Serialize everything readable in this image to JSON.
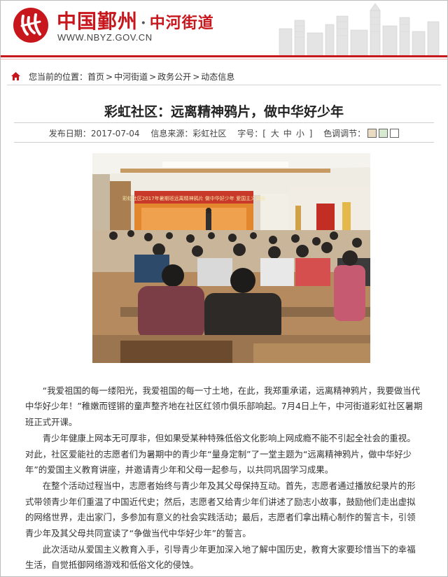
{
  "header": {
    "site_name": "中国鄞州",
    "dot": "·",
    "subsite": "中河街道",
    "url": "WWW.NBYZ.GOV.CN",
    "logo_icon": "yz-logo-icon",
    "accent_color": "#c8161d"
  },
  "breadcrumb": {
    "prefix": "您当前的位置：",
    "items": [
      "首页",
      "中河街道",
      "政务公开",
      "动态信息"
    ],
    "separator": ">"
  },
  "article": {
    "title": "彩虹社区：远离精神鸦片，做中华好少年",
    "date_label": "发布日期：",
    "date": "2017-07-04",
    "source_label": "信息来源：",
    "source": "彩虹社区",
    "font_label": "字号：",
    "font_open": "[",
    "font_large": "大",
    "font_medium": "中",
    "font_small": "小",
    "font_close": "]",
    "color_label": "色调调节：",
    "swatch_colors": [
      "#e9dcc0",
      "#d7ead0",
      "#ffffff"
    ],
    "paragraphs": [
      "“我爱祖国的每一缕阳光，我爱祖国的每一寸土地，在此，我郑重承诺，远离精神鸦片，我要做当代中华好少年！”稚嫩而铿锵的童声整齐地在社区红领巾俱乐部响起。7月4日上午，中河街道彩虹社区暑期班正式开课。",
      "青少年健康上网本无可厚非，但如果受某种特殊低俗文化影响上网成瘾不能不引起全社会的重视。对此，社区爱能社的志愿者们为暑期中的青少年“量身定制”了一堂主题为“远离精神鸦片，做中华好少年”的爱国主义教育讲座，并邀请青少年和父母一起参与，以共同巩固学习成果。",
      "在整个活动过程当中，志愿者始终与青少年及其父母保持互动。首先，志愿者通过播放纪录片的形式带领青少年们重温了中国近代史；然后，志愿者又给青少年们讲述了励志小故事，鼓励他们走出虚拟的网络世界，走出家门，多参加有意义的社会实践活动；最后，志愿者们拿出精心制作的誓言卡，引领青少年及其父母共同宣读了“争做当代中华好少年”的誓言。",
      "此次活动从爱国主义教育入手，引导青少年更加深入地了解中国历史，教育大家要珍惜当下的幸福生活，自觉抵御网络游戏和低俗文化的侵蚀。"
    ]
  },
  "photo": {
    "banner_text": "彩虹社区2017年暑期班远离精神鸦片 做中华好少年 爱国主义讲座"
  }
}
